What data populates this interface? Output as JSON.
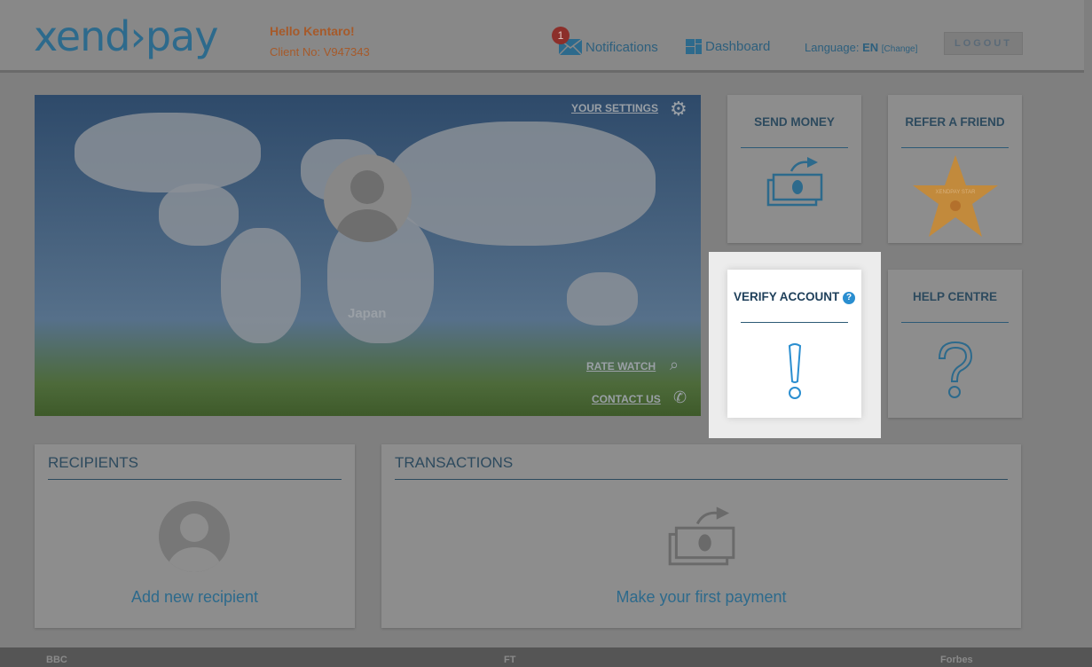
{
  "header": {
    "logo": "xend›pay",
    "greeting": "Hello Kentaro!",
    "client_no": "Client No: V947343",
    "notifications_label": "Notifications",
    "notifications_count": "1",
    "dashboard_label": "Dashboard",
    "language_label": "Language:",
    "language_value": "EN",
    "language_change": "[Change]",
    "logout_label": "LOGOUT"
  },
  "hero": {
    "settings_label": "YOUR SETTINGS",
    "country": "Japan",
    "rate_watch_label": "RATE WATCH",
    "contact_us_label": "CONTACT US"
  },
  "tiles": {
    "send_money": "SEND MONEY",
    "refer_friend": "REFER A FRIEND",
    "star_text": "XENDPAY STAR",
    "verify_account": "VERIFY ACCOUNT",
    "help_centre": "HELP CENTRE"
  },
  "recipients": {
    "title": "RECIPIENTS",
    "action": "Add new recipient"
  },
  "transactions": {
    "title": "TRANSACTIONS",
    "action": "Make your first payment"
  },
  "footer": {
    "logos": [
      "BBC",
      "FT",
      "Forbes"
    ]
  },
  "colors": {
    "accent": "#2a8ed0",
    "brand": "#2d6a8c",
    "greeting": "#a65a2a",
    "star": "#c28a3c"
  }
}
